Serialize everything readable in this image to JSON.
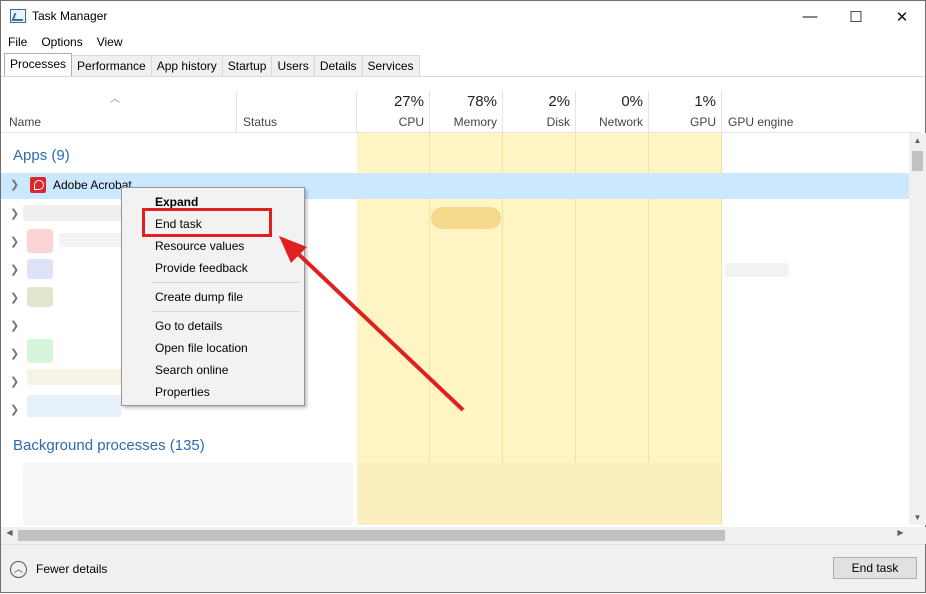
{
  "window": {
    "title": "Task Manager",
    "minimize": "—",
    "maximize": "☐",
    "close": "✕"
  },
  "menu": [
    "File",
    "Options",
    "View"
  ],
  "tabs": [
    "Processes",
    "Performance",
    "App history",
    "Startup",
    "Users",
    "Details",
    "Services"
  ],
  "columns": {
    "name": "Name",
    "status": "Status",
    "cpu": {
      "pct": "27%",
      "label": "CPU"
    },
    "memory": {
      "pct": "78%",
      "label": "Memory"
    },
    "disk": {
      "pct": "2%",
      "label": "Disk"
    },
    "network": {
      "pct": "0%",
      "label": "Network"
    },
    "gpu": {
      "pct": "1%",
      "label": "GPU"
    },
    "gpu_engine": "GPU engine"
  },
  "groups": {
    "apps": "Apps (9)",
    "background": "Background processes (135)"
  },
  "selected_row": {
    "name": "Adobe Acrobat"
  },
  "context_menu": [
    "Expand",
    "End task",
    "Resource values",
    "Provide feedback",
    "Create dump file",
    "Go to details",
    "Open file location",
    "Search online",
    "Properties"
  ],
  "footer": {
    "fewer_details": "Fewer details",
    "end_task": "End task"
  },
  "colors": {
    "accent": "#2b6bb3",
    "selection": "#cce8ff",
    "metric_column": "#fff4c4",
    "highlight": "#e02020"
  }
}
